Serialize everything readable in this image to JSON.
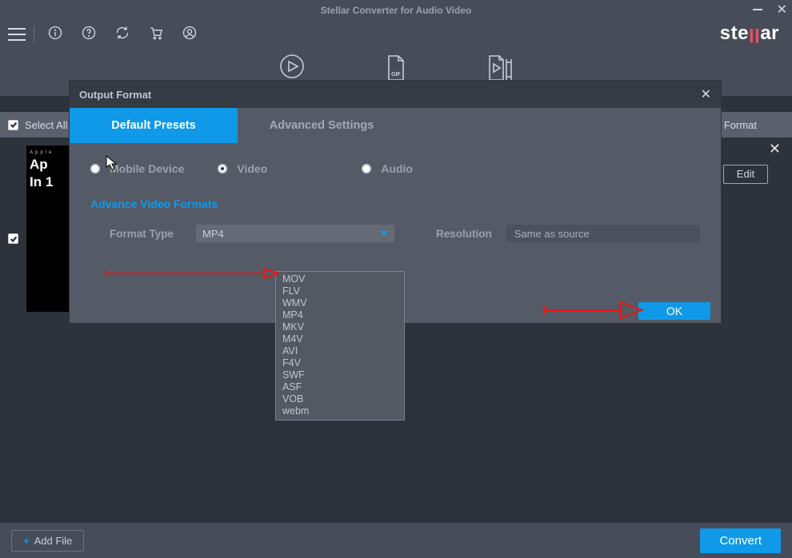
{
  "window": {
    "title": "Stellar Converter for Audio Video",
    "brand": "stellar"
  },
  "toolbar": {
    "icons": [
      "menu",
      "info",
      "help",
      "refresh",
      "cart",
      "user"
    ]
  },
  "main_tabs": [
    "play",
    "gif",
    "media-tools"
  ],
  "list": {
    "select_all_label": "Select All",
    "output_format_chip": "t Format",
    "edit_label": "Edit",
    "thumb_small": "Apple",
    "thumb_line1": "Ap",
    "thumb_line2": "In 1"
  },
  "bottom": {
    "add_file_label": "Add File",
    "convert_label": "Convert"
  },
  "modal": {
    "title": "Output Format",
    "tabs": {
      "default": "Default Presets",
      "advanced": "Advanced Settings",
      "active": "default"
    },
    "radios": {
      "mobile": "Mobile Device",
      "video": "Video",
      "audio": "Audio",
      "selected": "video"
    },
    "section_title": "Advance Video Formats",
    "format_type_label": "Format Type",
    "format_type_value": "MP4",
    "format_type_options": [
      "MOV",
      "FLV",
      "WMV",
      "MP4",
      "MKV",
      "M4V",
      "AVI",
      "F4V",
      "SWF",
      "ASF",
      "VOB",
      "webm"
    ],
    "resolution_label": "Resolution",
    "resolution_value": "Same as source",
    "ok_label": "OK"
  }
}
